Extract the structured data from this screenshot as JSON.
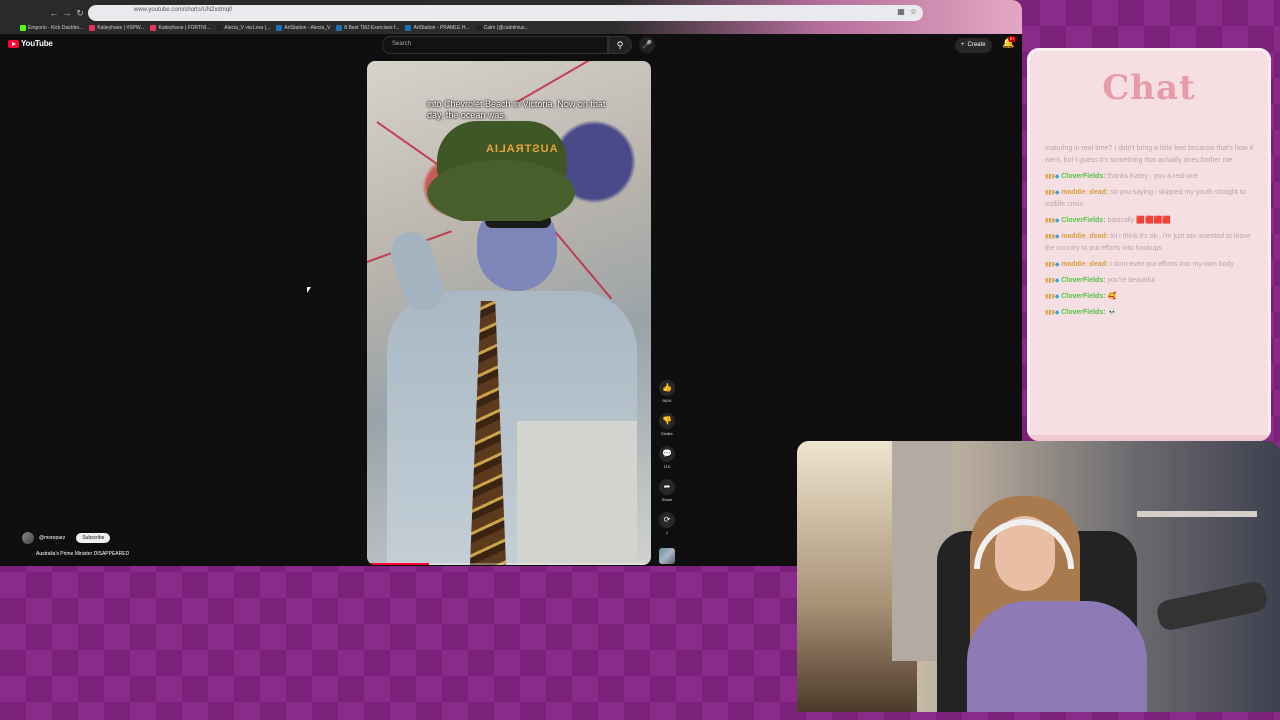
{
  "browser": {
    "url": "www.youtube.com/shorts/UN2xdmq0",
    "bookmarks": [
      {
        "label": "Emporio - Kick Dashbo...",
        "color": "#53fc18"
      },
      {
        "label": "Katieyhane | #SPW...",
        "color": "#e0365a"
      },
      {
        "label": "Katieyhane | FORTNI...",
        "color": "#e0365a"
      },
      {
        "label": "Alecia_V via Lera (...",
        "color": "#222222"
      },
      {
        "label": "ArtStation - Alecia_V",
        "color": "#1f6fb2"
      },
      {
        "label": "8 Best TMJ Exercises f...",
        "color": "#1f6fb2"
      },
      {
        "label": "ArtStation - PRAMLE H...",
        "color": "#1f6fb2"
      },
      {
        "label": "Calm (@calmlmus...",
        "color": "#222222"
      }
    ]
  },
  "youtube": {
    "logo": "YouTube",
    "search_placeholder": "Search",
    "create_label": "Create",
    "notification_count": "9+"
  },
  "short": {
    "caption": "into Chevrolet Beach in Victoria. Now on that day, the ocean was,",
    "hat_text": "AUSTRALIA",
    "progress": 0.22,
    "channel": "@moreparz",
    "subscribe_label": "Subscribe",
    "title": "Australia's Prime Minister DISAPPEARED",
    "actions": [
      {
        "icon": "like-icon",
        "glyph": "👍",
        "label": "561K"
      },
      {
        "icon": "dislike-icon",
        "glyph": "👎",
        "label": "Dislike"
      },
      {
        "icon": "comment-icon",
        "glyph": "💬",
        "label": "11K"
      },
      {
        "icon": "share-icon",
        "glyph": "➦",
        "label": "Share"
      },
      {
        "icon": "remix-icon",
        "glyph": "⟳",
        "label": "1"
      }
    ]
  },
  "chat": {
    "title": "Chat",
    "messages": [
      {
        "user": "",
        "color": "",
        "text": "maturing in real time? I didn't bring a little bee because that's how it went, but I guess it's something that actually does bother me"
      },
      {
        "user": "CloverFields",
        "color": "green",
        "text": "thanks Katey , you a real one"
      },
      {
        "user": "maddie_dead",
        "color": "orange",
        "text": "so you saying i skipped my youth straight to midlife crisis"
      },
      {
        "user": "CloverFields",
        "color": "green",
        "text": "basically 🟥🟥🟥🟥"
      },
      {
        "user": "maddie_dead",
        "color": "orange",
        "text": "lol i think it's ok . i'm just too invested to leave the country to put efforts into hookups"
      },
      {
        "user": "maddie_dead",
        "color": "orange",
        "text": "i dont even put efforts into my own body"
      },
      {
        "user": "CloverFields",
        "color": "green",
        "text": "you're beautiful"
      },
      {
        "user": "CloverFields",
        "color": "green",
        "text": "🥰"
      },
      {
        "user": "CloverFields",
        "color": "green",
        "text": "💀"
      }
    ]
  },
  "colors": {
    "yt_red": "#ff0033",
    "overlay_purple": "#8a2a8a",
    "chat_pink": "#f6dfe3",
    "chat_title": "#e79aa7",
    "user_green": "#58c442",
    "user_orange": "#d8a042"
  }
}
